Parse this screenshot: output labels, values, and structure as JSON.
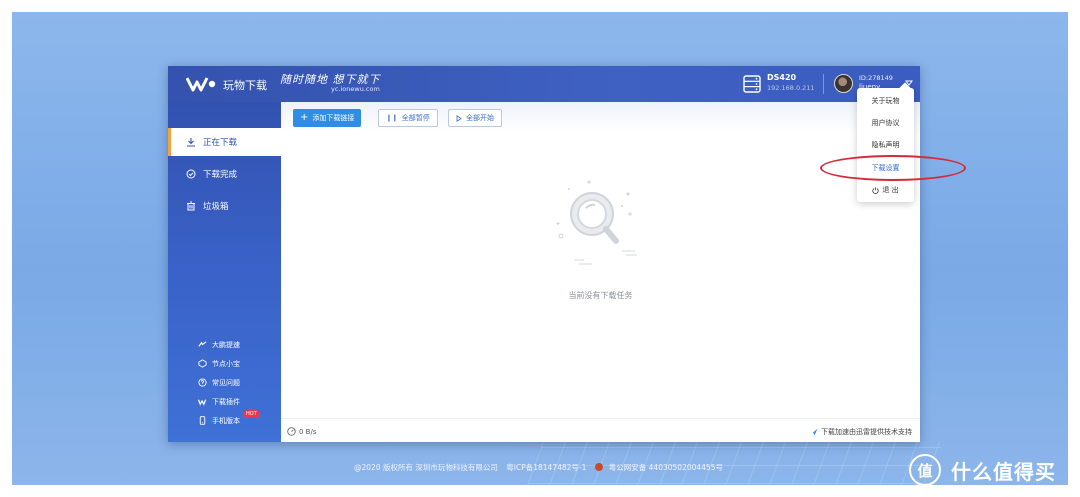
{
  "header": {
    "brand": "玩物下载",
    "slogan": "随时随地 想下就下",
    "slogan_url": "yc.ionewu.com",
    "nas_name": "DS420",
    "nas_ip": "192.168.0.211",
    "user_id": "ID:278149",
    "username": "liueny"
  },
  "sidebar": {
    "items": [
      {
        "label": "正在下载",
        "icon": "download-icon",
        "active": true
      },
      {
        "label": "下载完成",
        "icon": "check-circle-icon",
        "active": false
      },
      {
        "label": "垃圾箱",
        "icon": "trash-icon",
        "active": false
      }
    ],
    "extras": [
      {
        "label": "大鹏提速",
        "icon": "speed-icon"
      },
      {
        "label": "节点小宝",
        "icon": "node-icon"
      },
      {
        "label": "常见问题",
        "icon": "help-icon"
      },
      {
        "label": "下载插件",
        "icon": "plugin-icon"
      },
      {
        "label": "手机版本",
        "icon": "phone-icon",
        "badge": "HOT"
      }
    ]
  },
  "toolbar": {
    "add_label": "添加下载链接",
    "pause_all_label": "全部暂停",
    "start_all_label": "全部开始"
  },
  "empty": {
    "message": "当前没有下载任务"
  },
  "status": {
    "speed": "0 B/s",
    "support": "下载加速由迅雷提供技术支持"
  },
  "dropdown": {
    "items": [
      "关于玩物",
      "用户协议",
      "隐私声明",
      "下载设置",
      "退 出"
    ],
    "highlighted": "下载设置"
  },
  "footer": {
    "copyright": "@2020 版权所有 深圳市玩物科技有限公司",
    "icp": "粤ICP备18147482号-1",
    "police": "粤公网安备 44030502004455号"
  },
  "watermark": {
    "text": "什么值得买",
    "logo_char": "值"
  },
  "colors": {
    "accent": "#2f8de8",
    "sidebar": "#3a62c8",
    "highlight_ring": "#d42a3a",
    "active_marker": "#f3a13a"
  }
}
